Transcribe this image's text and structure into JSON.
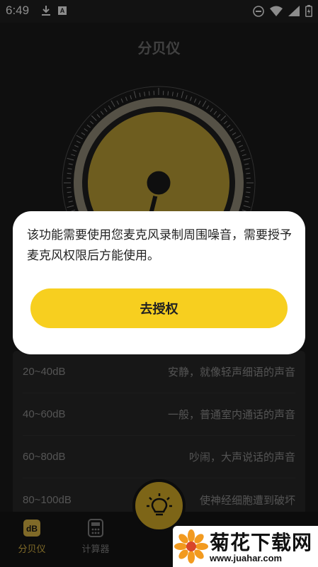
{
  "status_bar": {
    "time": "6:49",
    "left_icons": [
      "download-icon",
      "a-badge-icon"
    ],
    "a_badge_text": "A",
    "right_icons": [
      "dnd-icon",
      "wifi-icon",
      "signal-icon",
      "battery-icon"
    ]
  },
  "header": {
    "title": "分贝仪"
  },
  "db_list": [
    {
      "range": "20~40dB",
      "desc": "安静，就像轻声细语的声音"
    },
    {
      "range": "40~60dB",
      "desc": "一般，普通室内通话的声音"
    },
    {
      "range": "60~80dB",
      "desc": "吵闹，大声说话的声音"
    },
    {
      "range": "80~100dB",
      "desc": "使神经细胞遭到破坏"
    }
  ],
  "nav": {
    "items": [
      {
        "label": "分贝仪",
        "icon": "db-icon",
        "active": true
      },
      {
        "label": "计算器",
        "icon": "calculator-icon",
        "active": false
      }
    ],
    "fab_icon": "lightbulb-icon"
  },
  "watermark": {
    "title": "菊花下载网",
    "url": "www.juahar.com"
  },
  "dialog": {
    "message": "该功能需要使用您麦克风录制周围噪音，需要授予麦克风权限后方能使用。",
    "button_label": "去授权"
  },
  "colors": {
    "accent": "#f7cf1f",
    "gauge_face": "#c9a93a",
    "background": "#1c1c1c",
    "nav_active": "#e9c24a"
  }
}
